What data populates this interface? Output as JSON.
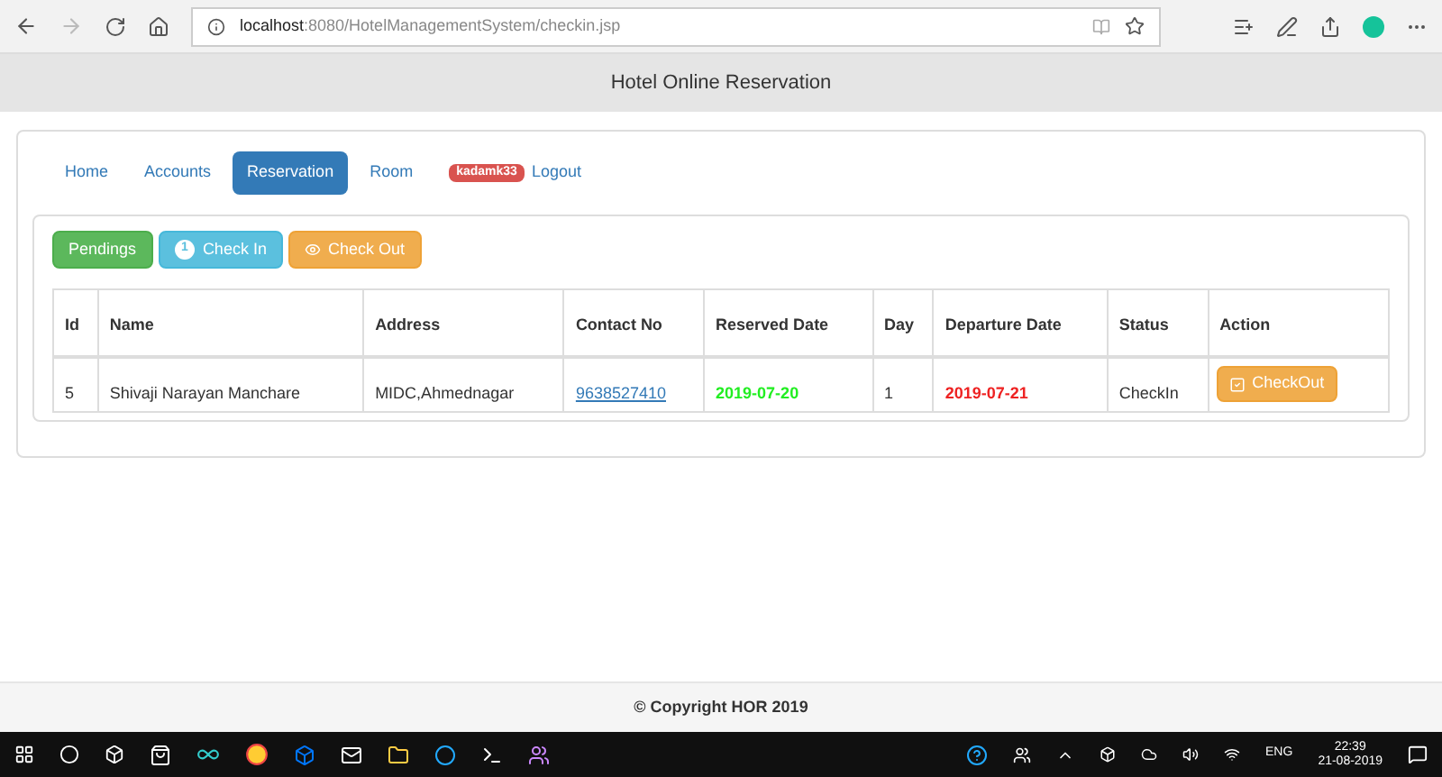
{
  "browser": {
    "url_host": "localhost",
    "url_rest": ":8080/HotelManagementSystem/checkin.jsp"
  },
  "header": {
    "title": "Hotel Online Reservation"
  },
  "nav": [
    {
      "label": "Home",
      "selected": false
    },
    {
      "label": "Accounts",
      "selected": false
    },
    {
      "label": "Reservation",
      "selected": true
    },
    {
      "label": "Room",
      "selected": false
    },
    {
      "label": "Logout",
      "selected": false,
      "badge": "kadamk33"
    }
  ],
  "actions": [
    {
      "label": "Pendings",
      "kind": "pendings"
    },
    {
      "label": "Check In",
      "kind": "checkin",
      "badge": "1"
    },
    {
      "label": "Check Out",
      "kind": "checkout"
    }
  ],
  "table": {
    "columns": [
      "Id",
      "Name",
      "Address",
      "Contact No",
      "Reserved Date",
      "Day",
      "Departure Date",
      "Status",
      "Action"
    ],
    "rows": [
      {
        "cells": [
          {
            "text": "5",
            "kind": "text"
          },
          {
            "text": "Shivaji Narayan Manchare",
            "kind": "text"
          },
          {
            "text": "MIDC,Ahmednagar",
            "kind": "text"
          },
          {
            "text": "9638527410",
            "kind": "link"
          },
          {
            "text": "2019-07-20",
            "kind": "date_in"
          },
          {
            "text": "1",
            "kind": "text"
          },
          {
            "text": "2019-07-21",
            "kind": "date_out"
          },
          {
            "text": "CheckIn",
            "kind": "text"
          },
          {
            "text": "CheckOut",
            "kind": "action"
          }
        ]
      }
    ]
  },
  "footer": {
    "text": "© Copyright HOR 2019"
  },
  "taskbar": {
    "language": "ENG",
    "time": "22:39",
    "date": "21-08-2019"
  }
}
